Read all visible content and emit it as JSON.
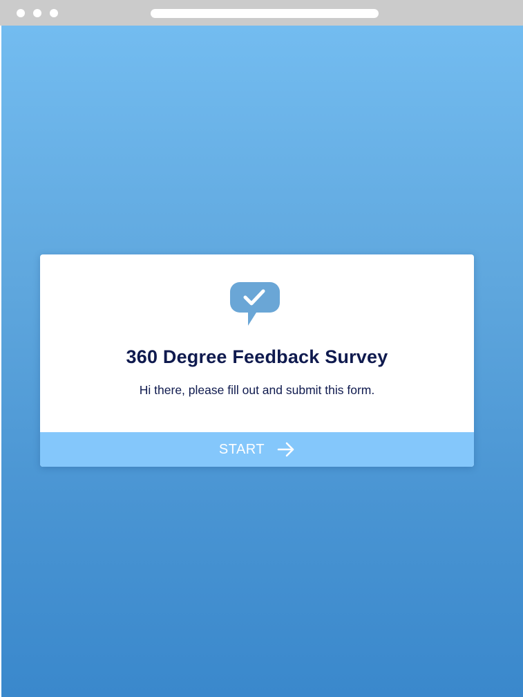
{
  "survey": {
    "title": "360 Degree Feedback Survey",
    "subtitle": "Hi there, please fill out and submit this form.",
    "start_label": "START",
    "icon": "chat-check-icon"
  },
  "colors": {
    "titlebar": "#cbcbcb",
    "background_top": "#73bcf0",
    "background_bottom": "#3a88cc",
    "card": "#ffffff",
    "title_text": "#0f1a4e",
    "icon": "#6aa6d6",
    "start_button": "#84c7fb"
  }
}
